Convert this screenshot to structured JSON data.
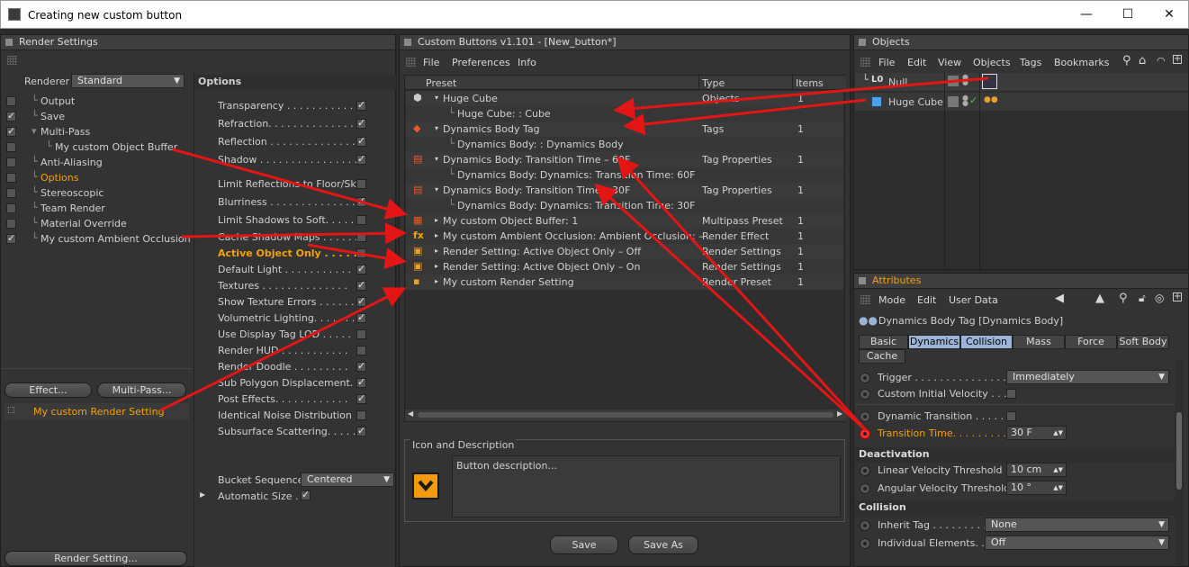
{
  "window": {
    "title": "Creating new custom button",
    "min": "—",
    "max": "☐",
    "close": "✕"
  },
  "render": {
    "header": "Render Settings",
    "renderer_label": "Renderer",
    "renderer_value": "Standard",
    "items": [
      {
        "label": "Output",
        "check": false
      },
      {
        "label": "Save",
        "check": true
      },
      {
        "label": "Multi-Pass",
        "check": true
      },
      {
        "label": "My custom Object Buffer",
        "check": false
      },
      {
        "label": "Anti-Aliasing",
        "check": false
      },
      {
        "label": "Options",
        "check": false
      },
      {
        "label": "Stereoscopic",
        "check": false
      },
      {
        "label": "Team Render",
        "check": false
      },
      {
        "label": "Material Override",
        "check": false
      },
      {
        "label": "My custom Ambient Occlusion",
        "check": true
      }
    ],
    "effect_btn": "Effect...",
    "multipass_btn": "Multi-Pass...",
    "preset": "My custom Render Setting",
    "rs_btn": "Render Setting..."
  },
  "options": {
    "header": "Options",
    "rows": [
      {
        "label": "Transparency . . . . . . . . . . . . .",
        "checked": true
      },
      {
        "label": "Refraction. . . . . . . . . . . . . . .",
        "checked": true
      },
      {
        "label": "Reflection . . . . . . . . . . . . . .",
        "checked": true
      },
      {
        "label": "Shadow . . . . . . . . . . . . . . . .",
        "checked": true
      },
      {
        "label": "Limit Reflections to Floor/Sky",
        "checked": false
      },
      {
        "label": "Blurriness . . . . . . . . . . . . . .",
        "checked": true
      },
      {
        "label": "Limit Shadows to Soft. . . . . .",
        "checked": false
      },
      {
        "label": "Cache Shadow Maps . . . . . .",
        "checked": false
      },
      {
        "label": "Active Object Only . . . . . . .",
        "checked": false
      },
      {
        "label": "Default Light . . . . . . . . . . .",
        "checked": true
      },
      {
        "label": "Textures . . . . . . . . . . . . . .",
        "checked": true
      },
      {
        "label": "Show Texture Errors . . . . . .",
        "checked": true
      },
      {
        "label": "Volumetric Lighting. . . . . . .",
        "checked": true
      },
      {
        "label": "Use Display Tag LOD . . . . .",
        "checked": false
      },
      {
        "label": "Render HUD . . . . . . . . . . .",
        "checked": false
      },
      {
        "label": "Render Doodle . . . . . . . . .",
        "checked": true
      },
      {
        "label": "Sub Polygon Displacement. .",
        "checked": true
      },
      {
        "label": "Post Effects. . . . . . . . . . . .",
        "checked": true
      },
      {
        "label": "Identical Noise Distribution",
        "checked": false
      },
      {
        "label": "Subsurface Scattering. . . . .",
        "checked": true
      }
    ],
    "bucket_label": "Bucket Sequence",
    "bucket_value": "Centered",
    "auto_label": "Automatic Size . ."
  },
  "cb": {
    "header": "Custom Buttons v1.101 - [New_button*]",
    "menu": [
      "File",
      "Preferences",
      "Info"
    ],
    "col_preset": "Preset",
    "col_type": "Type",
    "col_items": "Items",
    "rows": [
      {
        "label": "Huge Cube",
        "type": "Objects",
        "items": "1",
        "child": "Huge Cube: : Cube"
      },
      {
        "label": "Dynamics Body Tag",
        "type": "Tags",
        "items": "1",
        "child": "Dynamics Body: : Dynamics Body"
      },
      {
        "label": "Dynamics Body: Transition Time – 60F",
        "type": "Tag Properties",
        "items": "1",
        "child": "Dynamics Body: Dynamics: Transition Time: 60F"
      },
      {
        "label": "Dynamics Body: Transition Time – 30F",
        "type": "Tag Properties",
        "items": "1",
        "child": "Dynamics Body: Dynamics: Transition Time: 30F"
      },
      {
        "label": "My custom Object Buffer: 1",
        "type": "Multipass Preset",
        "items": "1"
      },
      {
        "label": "My custom Ambient Occlusion: Ambient Occlusion: –",
        "type": "Render Effect",
        "items": "1"
      },
      {
        "label": "Render Setting: Active Object Only – Off",
        "type": "Render Settings",
        "items": "1"
      },
      {
        "label": "Render Setting: Active Object Only – On",
        "type": "Render Settings",
        "items": "1"
      },
      {
        "label": "My custom Render Setting",
        "type": "Render Preset",
        "items": "1"
      }
    ],
    "icon_desc_label": "Icon and Description",
    "desc": "Button description...",
    "save": "Save",
    "save_as": "Save As"
  },
  "objects": {
    "header": "Objects",
    "menu": [
      "File",
      "Edit",
      "View",
      "Objects",
      "Tags",
      "Bookmarks"
    ],
    "null_label": "Null",
    "cube_label": "Huge Cube"
  },
  "attr": {
    "header": "Attributes",
    "menu": [
      "Mode",
      "Edit",
      "User Data"
    ],
    "title": "Dynamics Body Tag [Dynamics Body]",
    "tabs": [
      "Basic",
      "Dynamics",
      "Collision",
      "Mass",
      "Force",
      "Soft Body",
      "Cache"
    ],
    "trigger_label": "Trigger . . . . . . . . . . . . . . .",
    "trigger_value": "Immediately",
    "civ_label": "Custom Initial Velocity . . .",
    "dt_label": "Dynamic Transition . . . . . .",
    "tt_label": "Transition Time. . . . . . . . .",
    "tt_value": "30 F",
    "deact": "Deactivation",
    "lvt_label": "Linear Velocity Threshold",
    "lvt_value": "10 cm",
    "avt_label": "Angular Velocity Threshold",
    "avt_value": "10 °",
    "coll": "Collision",
    "inherit_label": "Inherit Tag . . . . . . . . . .",
    "inherit_value": "None",
    "ie_label": "Individual Elements. .",
    "ie_value": "Off"
  }
}
